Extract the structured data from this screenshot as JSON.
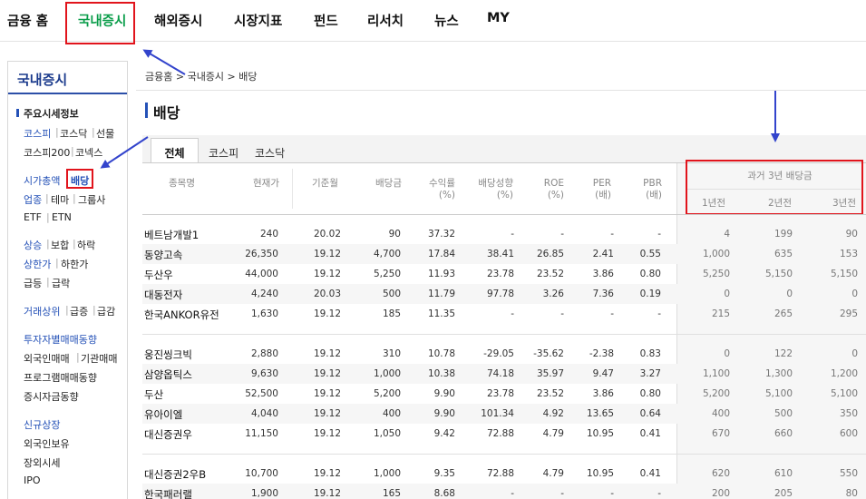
{
  "top_nav": {
    "items": [
      "금융 홈",
      "국내증시",
      "해외증시",
      "시장지표",
      "펀드",
      "리서치",
      "뉴스",
      "MY"
    ],
    "active_index": 1,
    "active_color": "#0a9d4a"
  },
  "sidebar": {
    "title": "국내증시",
    "groups": [
      {
        "heading": "주요시세정보",
        "lines": [
          [
            "코스피",
            "코스닥",
            "선물"
          ],
          [
            "코스피200",
            "코넥스"
          ]
        ]
      },
      {
        "lines": [
          [
            "시가총액",
            "배당"
          ],
          [
            "업종",
            "테마",
            "그룹사"
          ],
          [
            "ETF",
            "ETN"
          ]
        ]
      },
      {
        "lines": [
          [
            "상승",
            "보합",
            "하락"
          ],
          [
            "상한가",
            "하한가"
          ],
          [
            "급등",
            "급락"
          ]
        ]
      },
      {
        "lines": [
          [
            "거래상위",
            "급증",
            "급감"
          ]
        ]
      },
      {
        "lines": [
          [
            "투자자별매매동향"
          ],
          [
            "외국인매매",
            "기관매매"
          ],
          [
            "프로그램매매동향"
          ],
          [
            "증시자금동향"
          ]
        ]
      },
      {
        "lines": [
          [
            "신규상장"
          ],
          [
            "외국인보유"
          ],
          [
            "장외시세"
          ],
          [
            "IPO"
          ]
        ]
      }
    ]
  },
  "breadcrumb": "금융홈 > 국내증시 > 배당",
  "page_title": "배당",
  "tabs": [
    "전체",
    "코스피",
    "코스닥"
  ],
  "active_tab": "전체",
  "table": {
    "headers": {
      "name": "종목명",
      "price": "현재가",
      "base_month": "기준월",
      "dividend": "배당금",
      "yield": [
        "수익률",
        "(%)"
      ],
      "payout": [
        "배당성향",
        "(%)"
      ],
      "roe": [
        "ROE",
        "(%)"
      ],
      "per": [
        "PER",
        "(배)"
      ],
      "pbr": [
        "PBR",
        "(배)"
      ],
      "history_title": "과거 3년 배당금",
      "history_years": [
        "1년전",
        "2년전",
        "3년전"
      ]
    },
    "groups": [
      [
        [
          "베트남개발1",
          "240",
          "20.02",
          "90",
          "37.32",
          "-",
          "-",
          "-",
          "-",
          "4",
          "199",
          "90"
        ],
        [
          "동양고속",
          "26,350",
          "19.12",
          "4,700",
          "17.84",
          "38.41",
          "26.85",
          "2.41",
          "0.55",
          "1,000",
          "635",
          "153"
        ],
        [
          "두산우",
          "44,000",
          "19.12",
          "5,250",
          "11.93",
          "23.78",
          "23.52",
          "3.86",
          "0.80",
          "5,250",
          "5,150",
          "5,150"
        ],
        [
          "대동전자",
          "4,240",
          "20.03",
          "500",
          "11.79",
          "97.78",
          "3.26",
          "7.36",
          "0.19",
          "0",
          "0",
          "0"
        ],
        [
          "한국ANKOR유전",
          "1,630",
          "19.12",
          "185",
          "11.35",
          "-",
          "-",
          "-",
          "-",
          "215",
          "265",
          "295"
        ]
      ],
      [
        [
          "웅진씽크빅",
          "2,880",
          "19.12",
          "310",
          "10.78",
          "-29.05",
          "-35.62",
          "-2.38",
          "0.83",
          "0",
          "122",
          "0"
        ],
        [
          "삼양옵틱스",
          "9,630",
          "19.12",
          "1,000",
          "10.38",
          "74.18",
          "35.97",
          "9.47",
          "3.27",
          "1,100",
          "1,300",
          "1,200"
        ],
        [
          "두산",
          "52,500",
          "19.12",
          "5,200",
          "9.90",
          "23.78",
          "23.52",
          "3.86",
          "0.80",
          "5,200",
          "5,100",
          "5,100"
        ],
        [
          "유아이엘",
          "4,040",
          "19.12",
          "400",
          "9.90",
          "101.34",
          "4.92",
          "13.65",
          "0.64",
          "400",
          "500",
          "350"
        ],
        [
          "대신증권우",
          "11,150",
          "19.12",
          "1,050",
          "9.42",
          "72.88",
          "4.79",
          "10.95",
          "0.41",
          "670",
          "660",
          "600"
        ]
      ],
      [
        [
          "대신증권2우B",
          "10,700",
          "19.12",
          "1,000",
          "9.35",
          "72.88",
          "4.79",
          "10.95",
          "0.41",
          "620",
          "610",
          "550"
        ],
        [
          "한국패러랠",
          "1,900",
          "19.12",
          "165",
          "8.68",
          "-",
          "-",
          "-",
          "-",
          "200",
          "205",
          "80"
        ]
      ]
    ]
  },
  "annotation_color": "#e1141c",
  "arrow_color": "#3344cc"
}
